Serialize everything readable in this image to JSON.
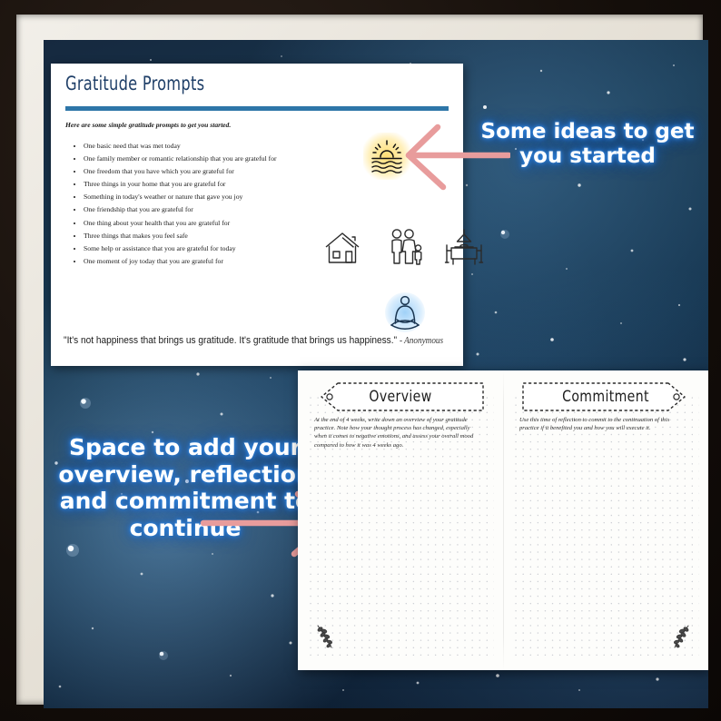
{
  "annotations": {
    "top_right": "Some ideas to get you started",
    "left": "Space to add your overview, reflection and commitment to continue"
  },
  "prompt_card": {
    "title": "Gratitude Prompts",
    "intro": "Here are some simple gratitude prompts to get you started.",
    "prompts": [
      "One basic need that was met today",
      "One family member or romantic relationship that you are grateful for",
      "One freedom that you have which you are grateful for",
      "Three things in your home that you are grateful for",
      "Something in today's weather or nature that gave you joy",
      "One friendship that you are grateful for",
      "One thing about your health that you are grateful for",
      "Three things that makes you feel safe",
      "Some help or assistance that you are grateful for today",
      "One moment of joy today that you are grateful for"
    ],
    "quote_text": "\"It's not happiness that brings us gratitude. It's gratitude that brings us happiness.\"",
    "quote_attribution": "- Anonymous",
    "icons": [
      "sunrise-over-water-icon",
      "house-icon",
      "family-icon",
      "dining-table-icon",
      "meditation-icon"
    ]
  },
  "journal": {
    "left_page": {
      "tag_label": "Overview",
      "body": "At the end of 4 weeks, write down an overview of your gratitude practice. Note how your thought process has changed, especially when it comes to negative emotions, and assess your overall mood compared to how it was 4 weeks ago."
    },
    "right_page": {
      "tag_label": "Commitment",
      "body": "Use this time of reflection to commit to the continuation of this practice if it benefited you and how you will execute it."
    }
  },
  "colors": {
    "title_navy": "#1f3f68",
    "rule_blue": "#2e76a8",
    "annotation_glow": "#2f7fd6",
    "arrow_pink": "#e89c9c",
    "page_white": "#fdfdfb",
    "frame_dark": "#140e0a",
    "mat_cream": "#e6e1d7"
  }
}
